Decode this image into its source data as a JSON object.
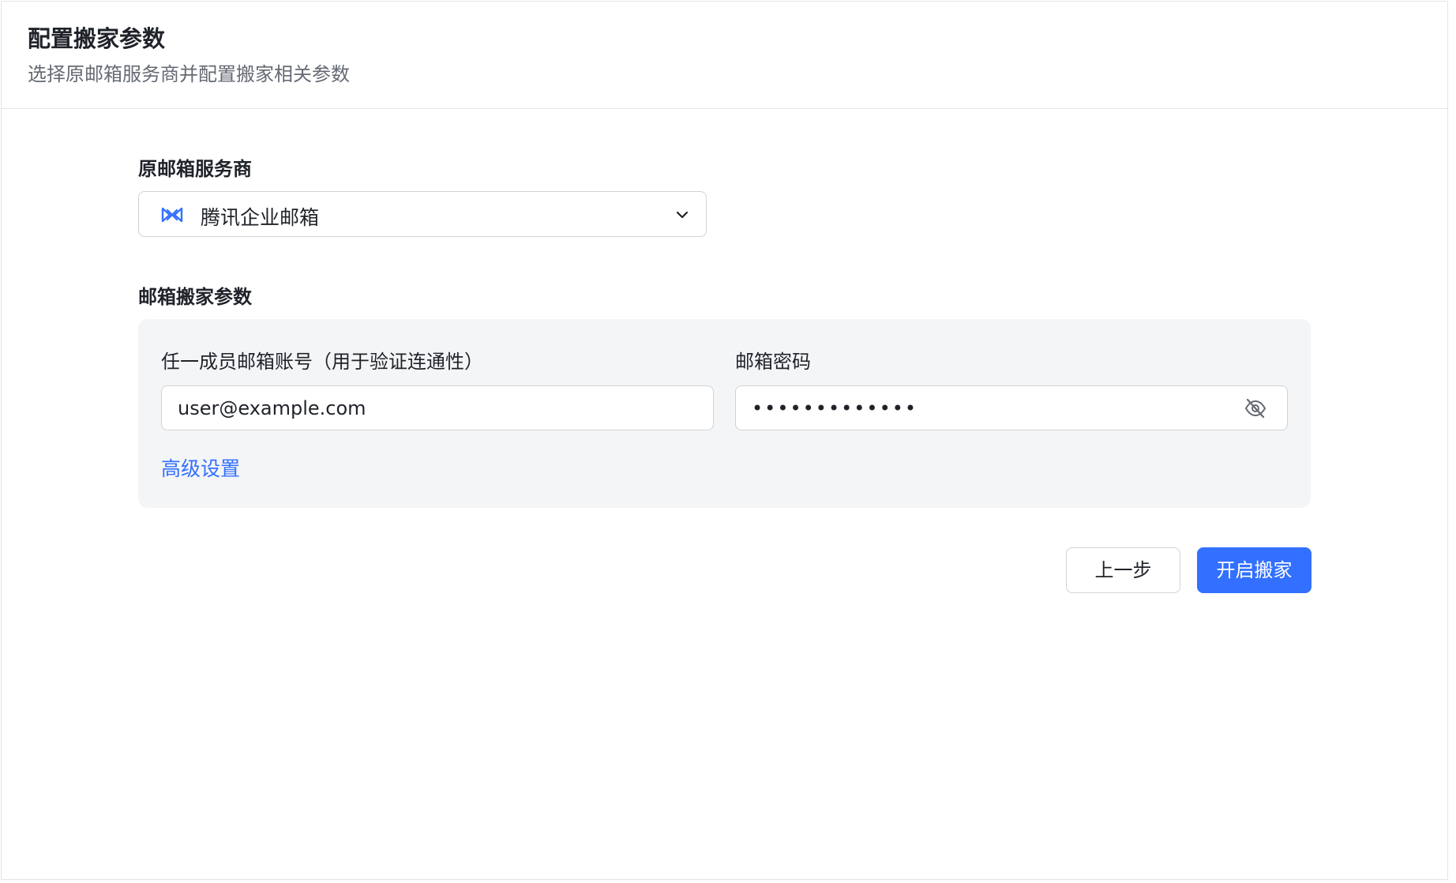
{
  "header": {
    "title": "配置搬家参数",
    "subtitle": "选择原邮箱服务商并配置搬家相关参数"
  },
  "provider": {
    "label": "原邮箱服务商",
    "selected": "腾讯企业邮箱",
    "icon": "tencent-exmail-logo-icon"
  },
  "params": {
    "label": "邮箱搬家参数",
    "account_label": "任一成员邮箱账号（用于验证连通性）",
    "account_value": "user@example.com",
    "password_label": "邮箱密码",
    "password_value": "•••••••••••••",
    "password_toggle_icon": "eye-off-icon",
    "advanced_link": "高级设置"
  },
  "actions": {
    "prev_label": "上一步",
    "start_label": "开启搬家"
  },
  "colors": {
    "accent": "#3370ff",
    "box_bg": "#f4f5f7",
    "border": "#d0d3d6"
  }
}
